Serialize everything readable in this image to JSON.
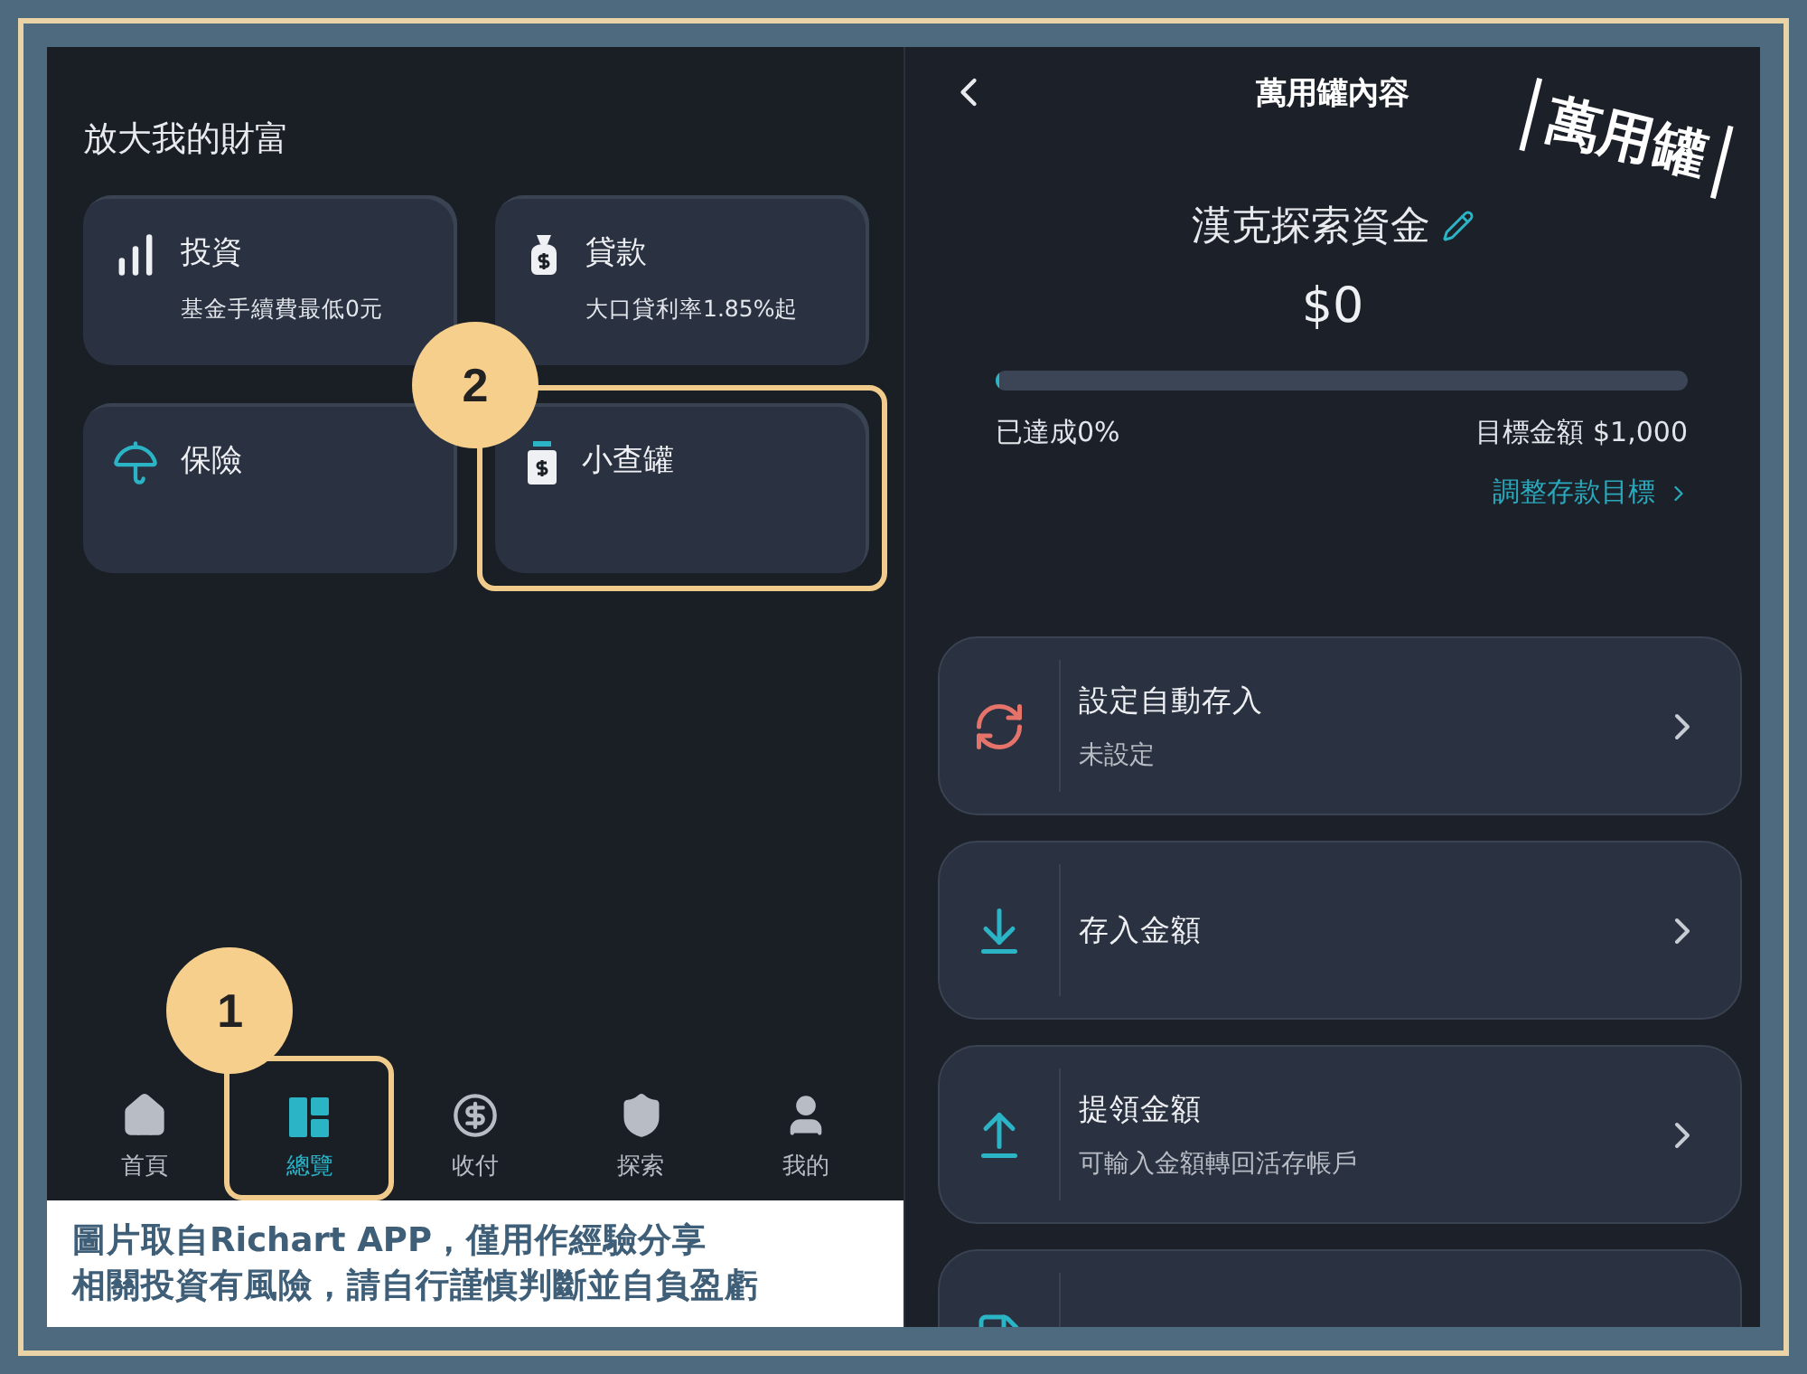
{
  "overview": {
    "heading": "放大我的財富",
    "cards": [
      {
        "kind": "invest",
        "title": "投資",
        "subtitle": "基金手續費最低0元",
        "highlighted": false
      },
      {
        "kind": "loan",
        "title": "貸款",
        "subtitle": "大口貸利率1.85%起",
        "highlighted": false
      },
      {
        "kind": "insurance",
        "title": "保險",
        "highlighted": false
      },
      {
        "kind": "jar",
        "title": "小查罐",
        "highlighted": true,
        "step": "2"
      }
    ],
    "nav": [
      {
        "kind": "home",
        "label": "首頁",
        "selected": false
      },
      {
        "kind": "overview",
        "label": "總覽",
        "selected": true,
        "step": "1"
      },
      {
        "kind": "pay",
        "label": "收付",
        "selected": false
      },
      {
        "kind": "explore",
        "label": "探索",
        "selected": false
      },
      {
        "kind": "me",
        "label": "我的",
        "selected": false
      }
    ],
    "caption": [
      "圖片取自Richart APP，僅用作經驗分享",
      "相關投資有風險，請自行謹慎判斷並自負盈虧"
    ]
  },
  "jar": {
    "title": "萬用罐內容",
    "callout": "萬用罐",
    "name": "漢克探索資金",
    "amount": "$0",
    "level": 0,
    "achieved": "已達成0%",
    "target": "目標金額 $1,000",
    "adjust_link": "調整存款目標",
    "actions": [
      {
        "kind": "auto",
        "title": "設定自動存入",
        "subtitle": "未設定"
      },
      {
        "kind": "deposit",
        "title": "存入金額"
      },
      {
        "kind": "withdraw",
        "title": "提領金額",
        "subtitle": "可輸入金額轉回活存帳戶"
      },
      {
        "kind": "other"
      }
    ]
  }
}
